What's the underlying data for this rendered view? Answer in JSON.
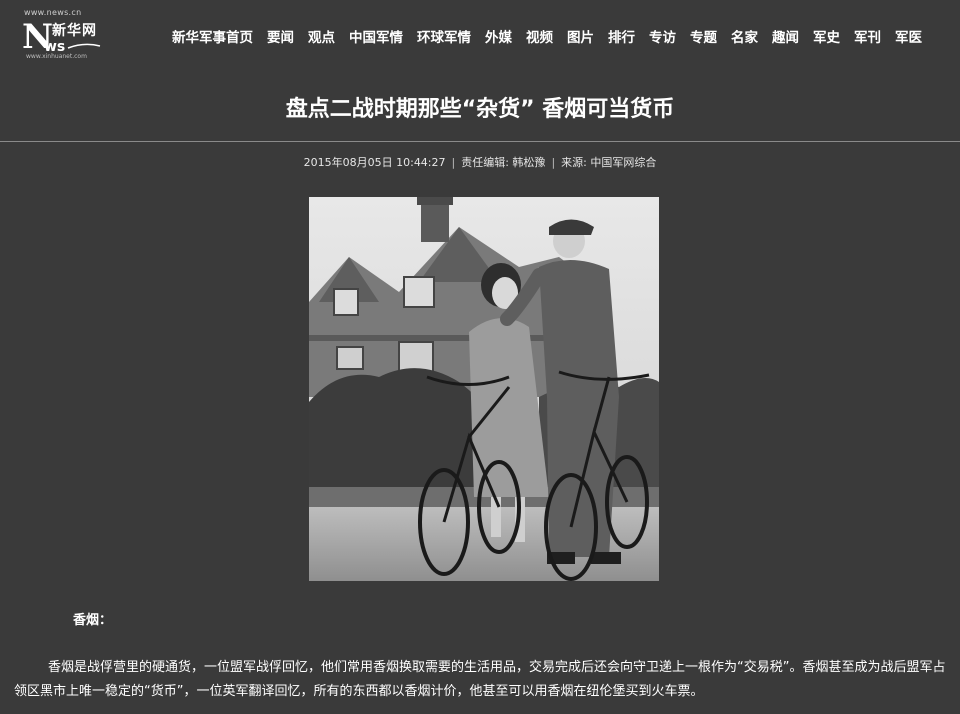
{
  "header": {
    "logo": {
      "site_url_text": "www.news.cn",
      "brand_cn": "新华网",
      "sub_url_text": "www.xinhuanet.com"
    },
    "nav": [
      {
        "label": "新华军事首页"
      },
      {
        "label": "要闻"
      },
      {
        "label": "观点"
      },
      {
        "label": "中国军情"
      },
      {
        "label": "环球军情"
      },
      {
        "label": "外媒"
      },
      {
        "label": "视频"
      },
      {
        "label": "图片"
      },
      {
        "label": "排行"
      },
      {
        "label": "专访"
      },
      {
        "label": "专题"
      },
      {
        "label": "名家"
      },
      {
        "label": "趣闻"
      },
      {
        "label": "军史"
      },
      {
        "label": "军刊"
      },
      {
        "label": "军医"
      }
    ]
  },
  "article": {
    "title": "盘点二战时期那些“杂货” 香烟可当货币",
    "meta": {
      "datetime": "2015年08月05日 10:44:27",
      "editor": "责任编辑: 韩松豫",
      "source": "来源: 中国军网综合"
    },
    "section_heading": "香烟：",
    "paragraph": "香烟是战俘营里的硬通货，一位盟军战俘回忆，他们常用香烟换取需要的生活用品，交易完成后还会向守卫递上一根作为“交易税”。香烟甚至成为战后盟军占领区黑市上唯一稳定的“货币”，一位英军翻译回忆，所有的东西都以香烟计价，他甚至可以用香烟在纽伦堡买到火车票。"
  },
  "colors": {
    "page_bg": "#3a3a3a",
    "text": "#ffffff",
    "rule": "#8a8a8a"
  }
}
